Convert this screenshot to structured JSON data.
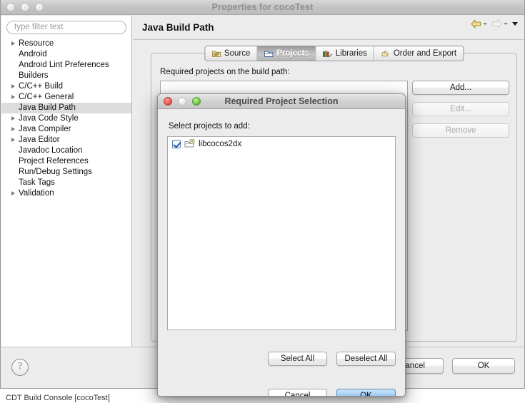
{
  "window": {
    "title": "Properties for cocoTest",
    "traffic_lights": [
      "close",
      "minimize",
      "zoom"
    ]
  },
  "sidebar": {
    "filter": {
      "value": "",
      "placeholder": "type filter text"
    },
    "items": [
      {
        "label": "Resource",
        "expandable": true,
        "selected": false
      },
      {
        "label": "Android",
        "expandable": false,
        "selected": false
      },
      {
        "label": "Android Lint Preferences",
        "expandable": false,
        "selected": false
      },
      {
        "label": "Builders",
        "expandable": false,
        "selected": false
      },
      {
        "label": "C/C++ Build",
        "expandable": true,
        "selected": false
      },
      {
        "label": "C/C++ General",
        "expandable": true,
        "selected": false
      },
      {
        "label": "Java Build Path",
        "expandable": false,
        "selected": true
      },
      {
        "label": "Java Code Style",
        "expandable": true,
        "selected": false
      },
      {
        "label": "Java Compiler",
        "expandable": true,
        "selected": false
      },
      {
        "label": "Java Editor",
        "expandable": true,
        "selected": false
      },
      {
        "label": "Javadoc Location",
        "expandable": false,
        "selected": false
      },
      {
        "label": "Project References",
        "expandable": false,
        "selected": false
      },
      {
        "label": "Run/Debug Settings",
        "expandable": false,
        "selected": false
      },
      {
        "label": "Task Tags",
        "expandable": false,
        "selected": false
      },
      {
        "label": "Validation",
        "expandable": true,
        "selected": false
      }
    ]
  },
  "content": {
    "page_title": "Java Build Path",
    "nav": {
      "back_icon": "back-arrow-icon",
      "forward_icon": "forward-arrow-icon",
      "menu_icon": "chevron-down-icon"
    },
    "tabs": [
      {
        "label": "Source",
        "icon": "source-folder-icon",
        "active": false
      },
      {
        "label": "Projects",
        "icon": "projects-folder-icon",
        "active": true
      },
      {
        "label": "Libraries",
        "icon": "libraries-books-icon",
        "active": false
      },
      {
        "label": "Order and Export",
        "icon": "order-export-icon",
        "active": false
      }
    ],
    "panel_label": "Required projects on the build path:",
    "side_buttons": [
      {
        "label": "Add...",
        "enabled": true
      },
      {
        "label": "Edit...",
        "enabled": false
      },
      {
        "label": "Remove",
        "enabled": false
      }
    ]
  },
  "footer": {
    "help_icon": "question-mark-icon",
    "buttons": [
      {
        "label": "Cancel",
        "default": false
      },
      {
        "label": "OK",
        "default": false
      }
    ]
  },
  "dialog": {
    "title": "Required Project Selection",
    "label": "Select projects to add:",
    "list": [
      {
        "label": "libcocos2dx",
        "checked": true,
        "icon": "java-project-icon"
      }
    ],
    "select_buttons": [
      {
        "label": "Select All"
      },
      {
        "label": "Deselect All"
      }
    ],
    "action_buttons": [
      {
        "label": "Cancel",
        "default": false
      },
      {
        "label": "OK",
        "default": true
      }
    ]
  },
  "background": {
    "status_text": "CDT Build Console [cocoTest]"
  },
  "colors": {
    "window_bg": "#ececec",
    "selection": "#dcdcdc",
    "default_button": "#74b2ef",
    "checkbox_accent": "#2356a8",
    "title_inactive": "#8e8e8e"
  }
}
